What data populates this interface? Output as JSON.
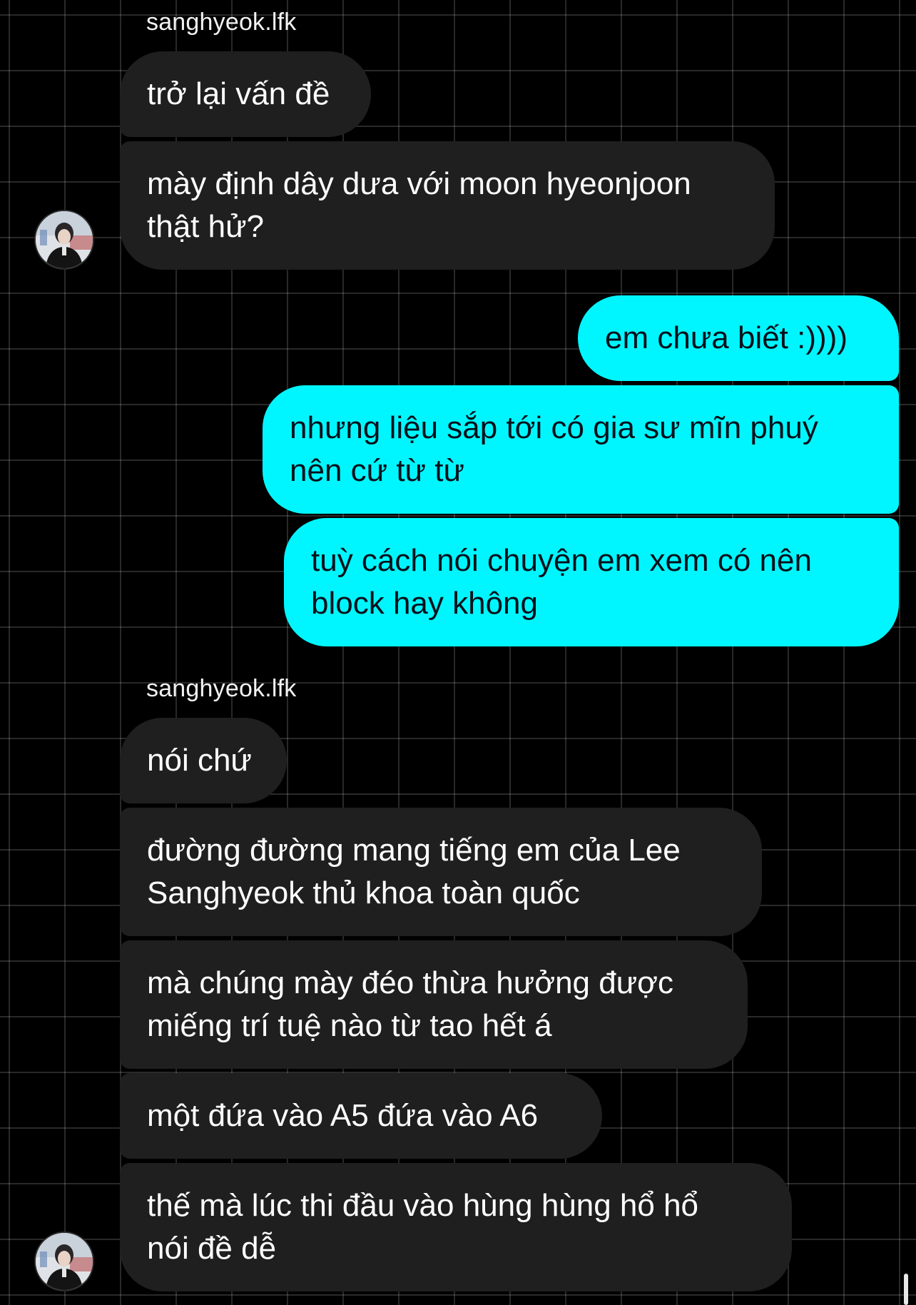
{
  "conversation": {
    "group_1": {
      "sender": "sanghyeok.lfk",
      "messages": [
        "trở lại vấn đề",
        "mày định dây dưa với moon hyeonjoon\nthật hử?"
      ]
    },
    "outgoing": {
      "messages": [
        "em chưa biết :))))",
        "nhưng liệu sắp tới có gia sư mĩn phuý\nnên cứ từ từ",
        "tuỳ cách nói chuyện em xem có nên\nblock hay không"
      ]
    },
    "group_2": {
      "sender": "sanghyeok.lfk",
      "messages": [
        "nói chứ",
        "đường đường mang tiếng em của Lee\nSanghyeok thủ khoa toàn quốc",
        "mà chúng mày đéo thừa hưởng được\nmiếng trí tuệ nào từ tao hết á",
        "một đứa vào A5 đứa vào A6",
        "thế mà lúc thi đầu vào hùng hùng hổ hổ\nnói đề dễ"
      ]
    }
  },
  "colors": {
    "background": "#000000",
    "incoming_bubble": "#1f1f1f",
    "outgoing_bubble": "#00f6ff",
    "outgoing_text": "#06101a"
  },
  "icons": {
    "avatar": "profile-photo-avatar"
  }
}
